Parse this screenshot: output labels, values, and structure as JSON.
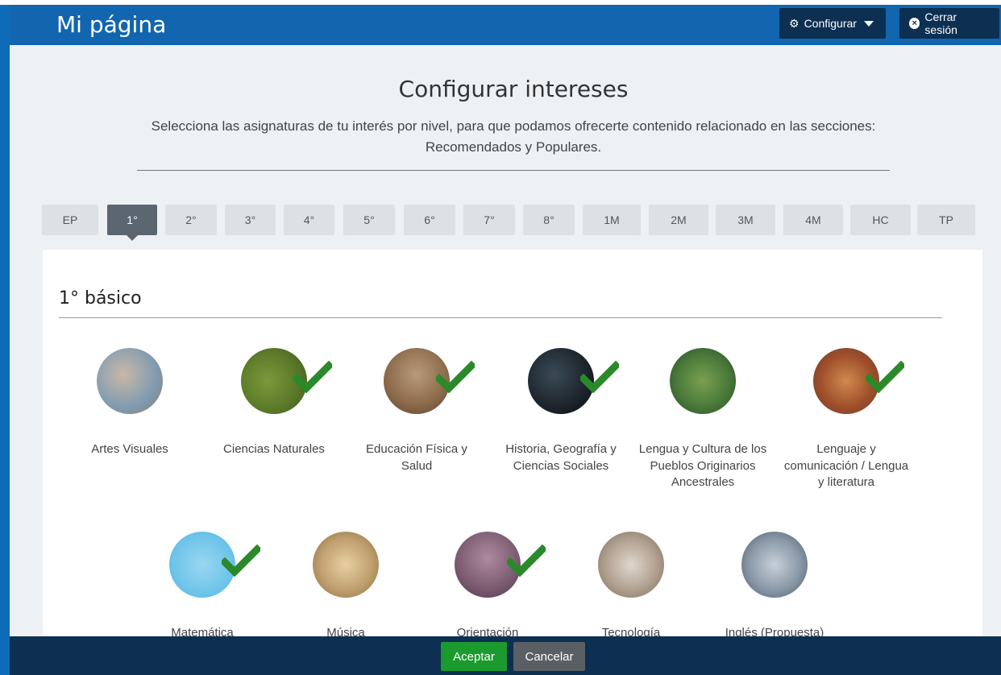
{
  "header": {
    "title": "Mi página",
    "configure_label": "Configurar",
    "logout_label": "Cerrar sesión"
  },
  "page": {
    "title": "Configurar intereses",
    "subtitle": "Selecciona las asignaturas de tu interés por nivel, para que podamos ofrecerte contenido relacionado en las secciones: Recomendados y Populares."
  },
  "levels": [
    "EP",
    "1°",
    "2°",
    "3°",
    "4°",
    "5°",
    "6°",
    "7°",
    "8°",
    "1M",
    "2M",
    "3M",
    "4M",
    "HC",
    "TP"
  ],
  "active_level": "1°",
  "section_title": "1° básico",
  "subjects": [
    {
      "name": "Artes Visuales",
      "selected": false
    },
    {
      "name": "Ciencias Naturales",
      "selected": true
    },
    {
      "name": "Educación Física y Salud",
      "selected": true
    },
    {
      "name": "Historia, Geografía y Ciencias Sociales",
      "selected": true
    },
    {
      "name": "Lengua y Cultura de los Pueblos Originarios Ancestrales",
      "selected": false
    },
    {
      "name": "Lenguaje y comunicación / Lengua y literatura",
      "selected": true
    },
    {
      "name": "Matemática",
      "selected": true
    },
    {
      "name": "Música",
      "selected": false
    },
    {
      "name": "Orientación",
      "selected": true
    },
    {
      "name": "Tecnología",
      "selected": false
    },
    {
      "name": "Inglés (Propuesta)",
      "selected": false
    }
  ],
  "footer": {
    "accept_label": "Aceptar",
    "cancel_label": "Cancelar"
  },
  "colors": {
    "header_bg": "#1266b0",
    "dark_navy": "#0d2f52",
    "accept_green": "#1b9a2e",
    "cancel_gray": "#5a5f64",
    "check_green": "#2a8a2a",
    "active_tab": "#5c6670"
  },
  "icons": {
    "configure": "gear-icon",
    "logout": "close-circle-icon",
    "check": "check-icon"
  }
}
